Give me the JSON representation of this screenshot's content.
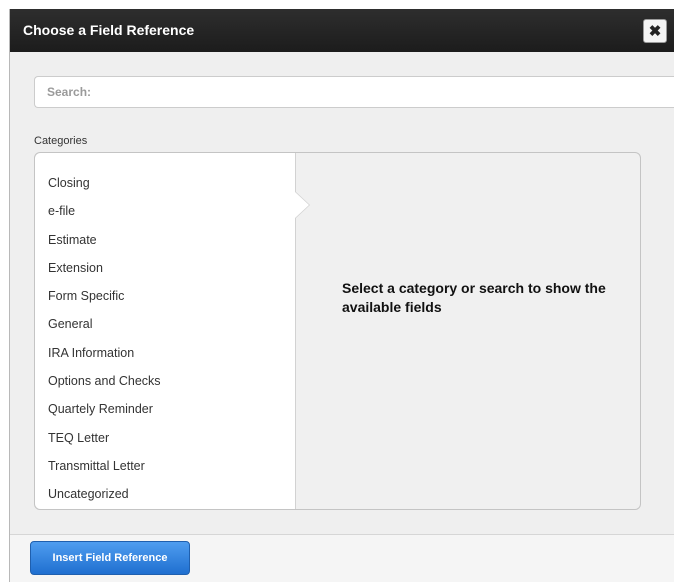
{
  "dialog": {
    "title": "Choose a Field Reference",
    "close_icon": "close-icon"
  },
  "search": {
    "placeholder": "Search:",
    "value": ""
  },
  "categories": {
    "label": "Categories",
    "items": [
      "Closing",
      "e-file",
      "Estimate",
      "Extension",
      "Form Specific",
      "General",
      "IRA Information",
      "Options and Checks",
      "Quartely Reminder",
      "TEQ Letter",
      "Transmittal Letter",
      "Uncategorized"
    ]
  },
  "fields_panel": {
    "empty_message": "Select a category or search to show the available fields"
  },
  "footer": {
    "insert_label": "Insert Field Reference"
  },
  "colors": {
    "titlebar": "#252525",
    "primary_button": "#2f7fe0"
  }
}
